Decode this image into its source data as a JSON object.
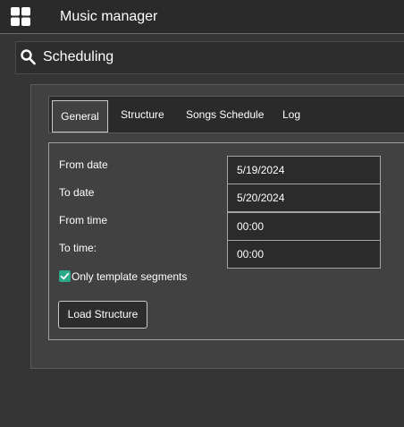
{
  "app": {
    "title": "Music manager",
    "icon": "grid-icon"
  },
  "search": {
    "icon": "search-icon",
    "text": "Scheduling"
  },
  "tabs": [
    {
      "label": "General",
      "active": true
    },
    {
      "label": "Structure",
      "active": false
    },
    {
      "label": "Songs Schedule",
      "active": false
    },
    {
      "label": "Log",
      "active": false
    }
  ],
  "form": {
    "fields": [
      {
        "label": "From date",
        "value": "5/19/2024"
      },
      {
        "label": "To date",
        "value": "5/20/2024"
      },
      {
        "label": "From time",
        "value": "00:00"
      },
      {
        "label": "To time:",
        "value": "00:00"
      }
    ],
    "checkbox": {
      "label": "Only template segments",
      "checked": true,
      "color": "#2aa88a"
    },
    "load_button": "Load Structure"
  },
  "colors": {
    "background": "#353535",
    "topbar": "#2a2a2a",
    "panel": "#414141",
    "accent": "#2aa88a"
  }
}
